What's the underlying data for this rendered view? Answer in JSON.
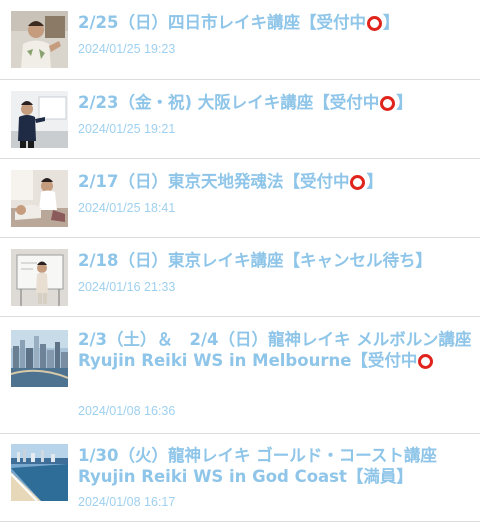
{
  "posts": [
    {
      "title_before": "2/25（日）四日市レイキ講座【受付中",
      "title_after": "】",
      "status_icon": "red-circle",
      "date": "2024/01/25 19:23"
    },
    {
      "title_before": "2/23（金・祝) 大阪レイキ講座【受付中",
      "title_after": "】",
      "status_icon": "red-circle",
      "date": "2024/01/25 19:21"
    },
    {
      "title_before": "2/17（日）東京天地発魂法【受付中",
      "title_after": "】",
      "status_icon": "red-circle",
      "date": "2024/01/25 18:41"
    },
    {
      "title_before": "2/18（日）東京レイキ講座【キャンセル待ち】",
      "title_after": "",
      "status_icon": "",
      "date": "2024/01/16 21:33"
    },
    {
      "title_before": "2/3（土）＆　2/4（日）龍神レイキ メルボルン講座 Ryujin Reiki WS in Melbourne【受付中",
      "title_after": "",
      "status_icon": "red-circle",
      "date": "2024/01/08 16:36"
    },
    {
      "title_before": "1/30（火）龍神レイキ ゴールド・コースト講座　Ryujin Reiki WS in God Coast【満員】",
      "title_after": "",
      "status_icon": "",
      "date": "2024/01/08 16:17"
    }
  ],
  "colors": {
    "link": "#8ec5e8",
    "date": "#9ed0ef",
    "circle": "#e0241b",
    "divider": "#dcdcdc"
  }
}
